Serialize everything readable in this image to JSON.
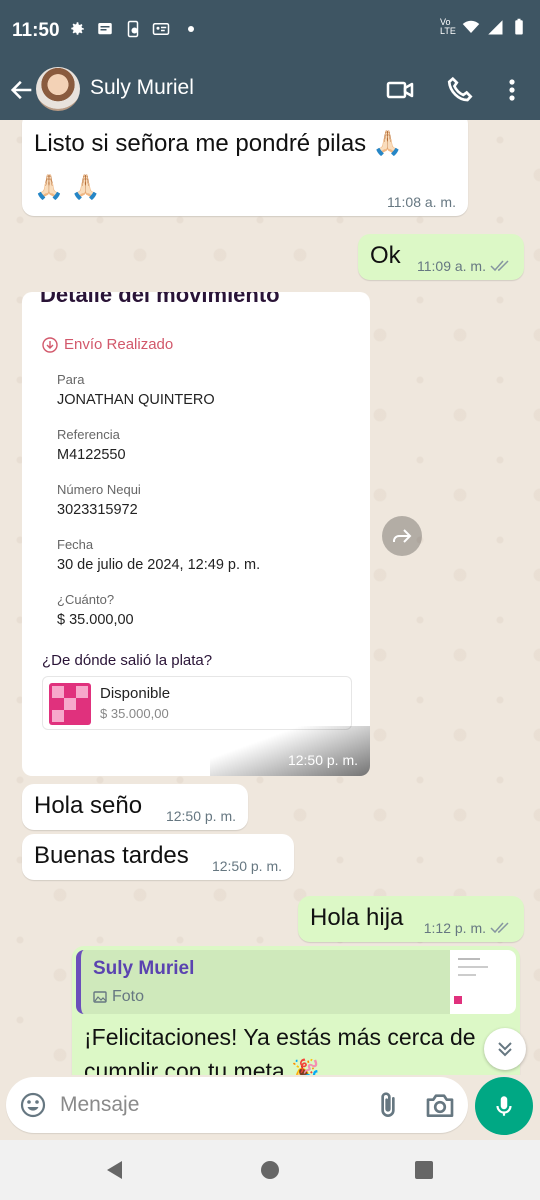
{
  "status_bar": {
    "time": "11:50",
    "volte": "Vo LTE"
  },
  "app_bar": {
    "contact_name": "Suly Muriel"
  },
  "messages": {
    "m1": {
      "text": "Listo si señora me pondré pilas 🙏🏻 🙏🏻 🙏🏻",
      "time": "11:08 a. m."
    },
    "m2": {
      "text": "Ok",
      "time": "11:09 a. m."
    },
    "m4": {
      "text": "Hola seño",
      "time": "12:50 p. m."
    },
    "m5": {
      "text": "Buenas tardes",
      "time": "12:50 p. m."
    },
    "m6": {
      "text": "Hola hija",
      "time": "1:12 p. m."
    },
    "m7": {
      "quote_name": "Suly Muriel",
      "quote_type": "Foto",
      "text": "¡Felicitaciones! Ya estás más cerca de cumplir con tu meta 🎉"
    }
  },
  "receipt": {
    "title": "Detalle del movimiento",
    "status": "Envío Realizado",
    "fields": [
      {
        "label": "Para",
        "value": "JONATHAN QUINTERO"
      },
      {
        "label": "Referencia",
        "value": "M4122550"
      },
      {
        "label": "Número Nequi",
        "value": "3023315972"
      },
      {
        "label": "Fecha",
        "value": "30 de julio de 2024, 12:49 p. m."
      },
      {
        "label": "¿Cuánto?",
        "value": "$ 35.000,00"
      }
    ],
    "source_question": "¿De dónde salió la plata?",
    "source_name": "Disponible",
    "source_amount": "$ 35.000,00",
    "time": "12:50 p. m."
  },
  "input": {
    "placeholder": "Mensaje"
  },
  "colors": {
    "header": "#3e5563",
    "outgoing": "#dcf8c6",
    "accent": "#00a884",
    "quote_bar": "#6b4fbb"
  }
}
